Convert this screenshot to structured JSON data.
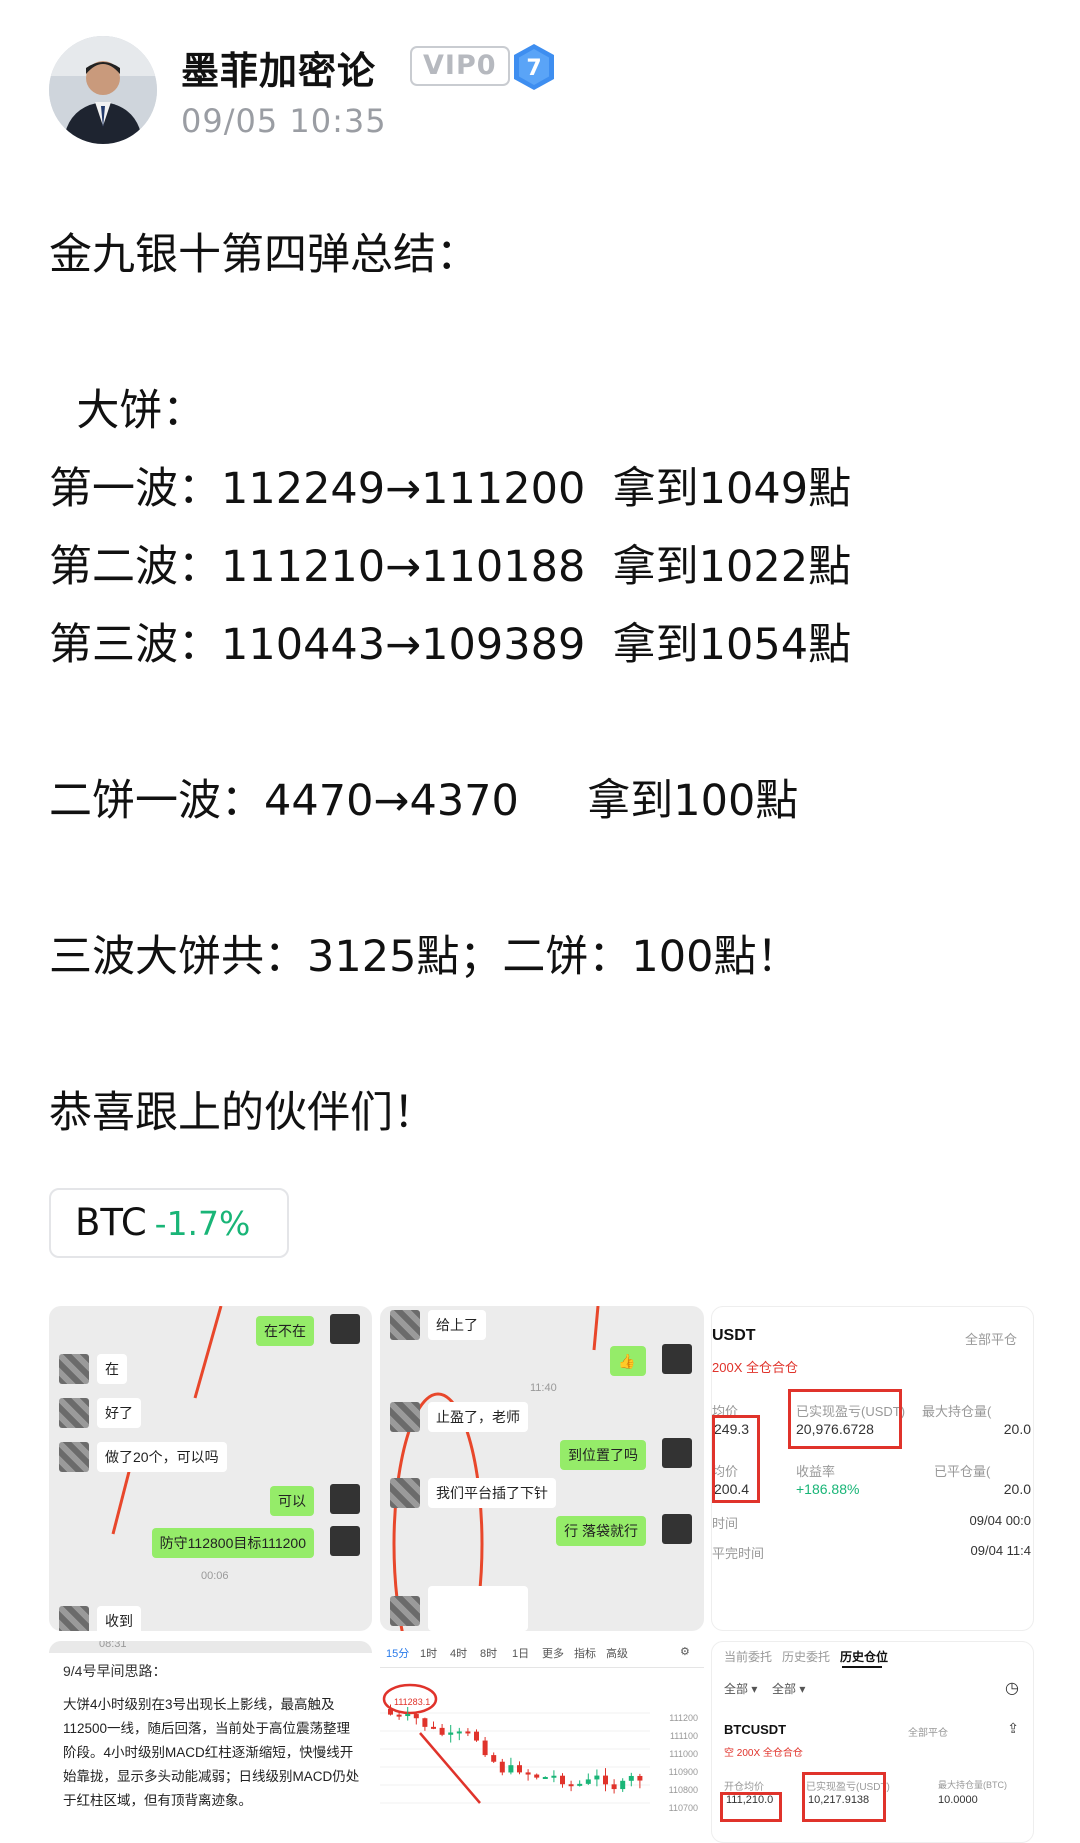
{
  "post": {
    "author": "墨菲加密论",
    "vip_badge": "VIP0",
    "level": "7",
    "timestamp": "09/05 10:35"
  },
  "content": {
    "lines": [
      "金九银十第四弹总结：",
      "",
      "  大饼：",
      "第一波：112249→111200  拿到1049點",
      "第二波：111210→110188  拿到1022點",
      "第三波：110443→109389  拿到1054點",
      "",
      "二饼一波：4470→4370     拿到100點",
      "",
      "三波大饼共：3125點；二饼：100點！",
      "",
      "恭喜跟上的伙伴们！"
    ]
  },
  "ticker": {
    "symbol": "BTC",
    "change": "-1.7%",
    "change_color": "#19b577"
  },
  "thumbs": {
    "chat1": {
      "m1": "在不在",
      "m2": "在",
      "m3": "好了",
      "m4": "做了20个，可以吗",
      "m5": "可以",
      "m6": "防守112800目标111200",
      "ts": "00:06",
      "m7": "收到"
    },
    "chat2": {
      "m1": "给上了",
      "ts": "11:40",
      "m2": "止盈了，老师",
      "m3": "到位置了吗",
      "m4": "我们平台插了下针",
      "m5": "行 落袋就行"
    },
    "pos1": {
      "pair": "USDT",
      "tag": "200X  全仓合仓",
      "close_all": "全部平仓",
      "avg_label": "均价",
      "avg": "249.3",
      "pnl_label": "已实现盈亏(USDT)",
      "pnl": "20,976.6728",
      "max_label": "最大持仓量(",
      "max": "20.0",
      "avg2_label": "均价",
      "avg2": "200.4",
      "roi_label": "收益率",
      "roi": "+186.88%",
      "closed_label": "已平仓量(",
      "closed": "20.0",
      "time_label": "时间",
      "time": "09/04 00:0",
      "close_time_label": "平完时间",
      "close_time": "09/04 11:4"
    },
    "note": {
      "header": "08:31",
      "title": "9/4号早间思路：",
      "body": "大饼4小时级别在3号出现长上影线，最高触及112500一线，随后回落，当前处于高位震荡整理阶段。4小时级别MACD红柱逐渐缩短，快慢线开始靠拢，显示多头动能减弱；日线级别MACD仍处于红柱区域，但有顶背离迹象。"
    },
    "chart": {
      "tabs": [
        "15分",
        "1时",
        "4时",
        "8时",
        "1日",
        "更多",
        "指标",
        "高级"
      ],
      "peak": "111283.1",
      "prices": [
        "111200",
        "111100",
        "111000",
        "110900",
        "110800",
        "110700"
      ]
    },
    "pos2": {
      "tabs": [
        "当前委托",
        "历史委托",
        "历史仓位"
      ],
      "filter1": "全部 ▾",
      "filter2": "全部 ▾",
      "pair": "BTCUSDT",
      "close_all": "全部平仓",
      "tag": "空  200X  全仓合仓",
      "open_label": "开仓均价",
      "open": "111,210.0",
      "pnl_label": "已实现盈亏(USDT)",
      "pnl": "10,217.9138",
      "max_label": "最大持仓量(BTC)",
      "max": "10.0000"
    }
  }
}
